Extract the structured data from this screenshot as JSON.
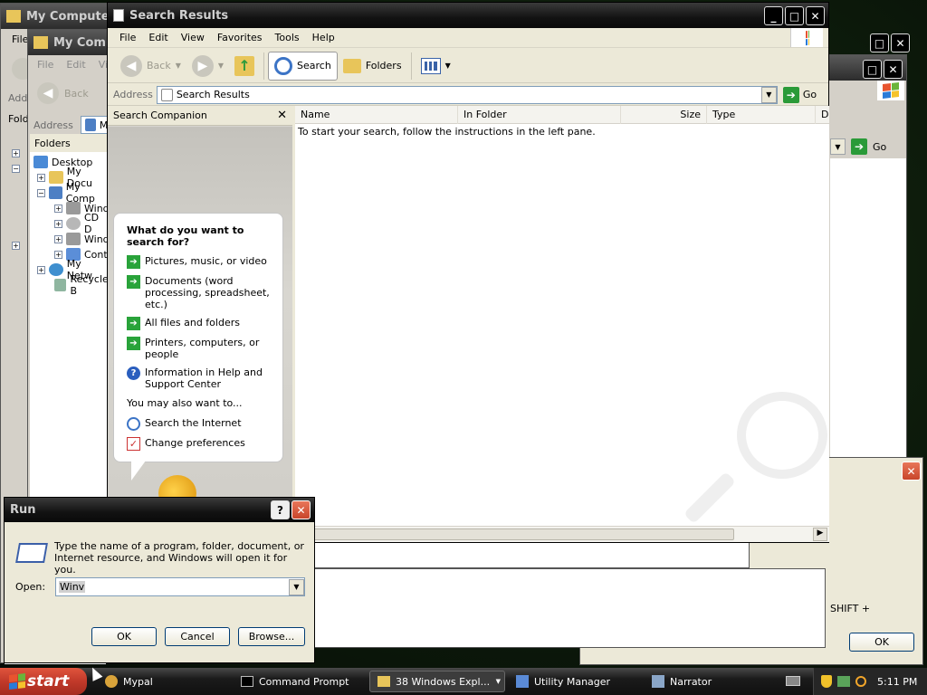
{
  "windows": {
    "back_mycomputer_1": {
      "title": "My Computer",
      "menu": [
        "File"
      ],
      "address_label": "Addr",
      "folders_label": "Fold"
    },
    "back_mycomputer_2": {
      "title": "My Comput",
      "menu": [
        "File",
        "Edit",
        "Vi"
      ],
      "back_label": "Back",
      "address_label": "Address",
      "address_value": "My",
      "folders_title": "Folders",
      "tree": [
        {
          "label": "Desktop",
          "sign": ""
        },
        {
          "label": "My Docu",
          "sign": "+"
        },
        {
          "label": "My Comp",
          "sign": "−"
        },
        {
          "label": "Wind",
          "sign": "+"
        },
        {
          "label": "CD D",
          "sign": "+"
        },
        {
          "label": "Wind",
          "sign": "+"
        },
        {
          "label": "Cont",
          "sign": "+"
        },
        {
          "label": "My Netw",
          "sign": "+"
        },
        {
          "label": "Recycle B",
          "sign": ""
        }
      ]
    },
    "right_window": {
      "go_label": "Go"
    },
    "partial_dialog": {
      "text": "SHIFT +",
      "ok_label": "OK"
    }
  },
  "search_results": {
    "title": "Search Results",
    "menu": [
      "File",
      "Edit",
      "View",
      "Favorites",
      "Tools",
      "Help"
    ],
    "toolbar": {
      "back": "Back",
      "search": "Search",
      "folders": "Folders"
    },
    "address_label": "Address",
    "address_value": "Search Results",
    "go_label": "Go",
    "companion": {
      "title": "Search Companion",
      "question": "What do you want to search for?",
      "options": [
        "Pictures, music, or video",
        "Documents (word processing, spreadsheet, etc.)",
        "All files and folders",
        "Printers, computers, or people",
        "Information in Help and Support Center"
      ],
      "also_heading": "You may also want to...",
      "also_options": [
        "Search the Internet",
        "Change preferences"
      ]
    },
    "columns": [
      "Name",
      "In Folder",
      "Size",
      "Type",
      "D"
    ],
    "empty_message": "To start your search, follow the instructions in the left pane."
  },
  "run_dialog": {
    "title": "Run",
    "description": "Type the name of a program, folder, document, or Internet resource, and Windows will open it for you.",
    "open_label": "Open:",
    "open_value": "Winv",
    "ok": "OK",
    "cancel": "Cancel",
    "browse": "Browse..."
  },
  "taskbar": {
    "start": "start",
    "tasks": [
      "Mypal",
      "Command Prompt",
      "38 Windows Expl...",
      "Utility Manager",
      "Narrator"
    ],
    "clock": "5:11 PM"
  },
  "colors": {
    "xp_green": "#29a33a",
    "close_red": "#c8452a",
    "start_red": "#c1392a"
  }
}
